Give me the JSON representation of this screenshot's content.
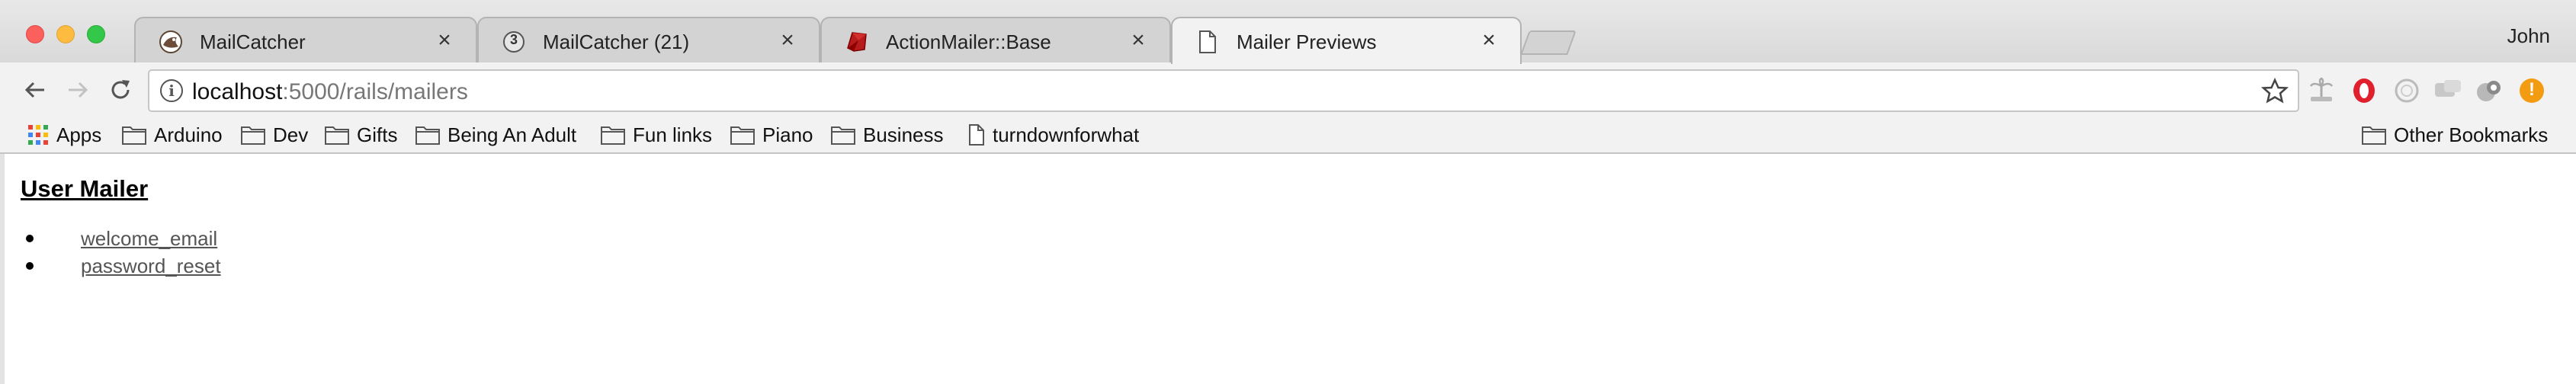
{
  "window": {
    "profile_name": "John"
  },
  "tabs": [
    {
      "title": "MailCatcher",
      "favicon": "mailcatcher-icon",
      "close": "×",
      "active": false
    },
    {
      "title": "MailCatcher (21)",
      "favicon": "mailcatcher-badge-icon",
      "badge": "3",
      "close": "×",
      "active": false
    },
    {
      "title": "ActionMailer::Base",
      "favicon": "ruby-icon",
      "close": "×",
      "active": false
    },
    {
      "title": "Mailer Previews",
      "favicon": "document-icon",
      "close": "×",
      "active": true
    }
  ],
  "toolbar": {
    "url_host": "localhost",
    "url_rest": ":5000/rails/mailers",
    "info_glyph": "i",
    "extensions": [
      "palm-tree-extension-icon",
      "opera-o-extension-icon",
      "circle-extension-icon",
      "chat-extension-icon",
      "puzzle-extension-icon",
      "orange-alert-extension-icon"
    ],
    "alert_glyph": "!"
  },
  "bookmarks": {
    "items": [
      {
        "label": "Apps",
        "icon": "apps-grid-icon"
      },
      {
        "label": "Arduino",
        "icon": "folder-icon"
      },
      {
        "label": "Dev",
        "icon": "folder-icon"
      },
      {
        "label": "Gifts",
        "icon": "folder-icon"
      },
      {
        "label": "Being An Adult",
        "icon": "folder-icon"
      },
      {
        "label": "Fun links",
        "icon": "folder-icon"
      },
      {
        "label": "Piano",
        "icon": "folder-icon"
      },
      {
        "label": "Business",
        "icon": "folder-icon"
      },
      {
        "label": "turndownforwhat",
        "icon": "page-icon"
      }
    ],
    "other": {
      "label": "Other Bookmarks",
      "icon": "folder-icon"
    }
  },
  "content": {
    "mailer_title": "User Mailer",
    "previews": [
      "welcome_email",
      "password_reset"
    ]
  },
  "colors": {
    "apps_grid": [
      "#ea4335",
      "#fbbc05",
      "#34a853",
      "#4285f4"
    ],
    "ruby_red": "#b71c1c",
    "alert_orange": "#f39c12",
    "opera_red": "#e0202c"
  }
}
